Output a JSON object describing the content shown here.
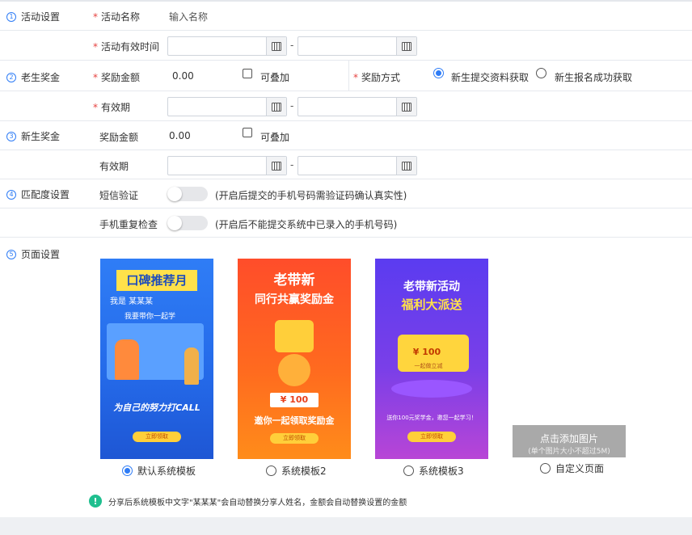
{
  "sections": {
    "activity": {
      "num": "1",
      "label": "活动设置"
    },
    "old": {
      "num": "2",
      "label": "老生奖金"
    },
    "new": {
      "num": "3",
      "label": "新生奖金"
    },
    "match": {
      "num": "4",
      "label": "匹配度设置"
    },
    "page": {
      "num": "5",
      "label": "页面设置"
    }
  },
  "activity": {
    "name_label": "活动名称",
    "name_placeholder": "输入名称",
    "time_label": "活动有效时间",
    "range_sep": "-"
  },
  "old_bonus": {
    "amount_label": "奖励金额",
    "amount_value": "0.00",
    "stackable_label": "可叠加",
    "stackable_checked": false,
    "method_label": "奖励方式",
    "method_options": [
      "新生提交资料获取",
      "新生报名成功获取"
    ],
    "method_selected": "新生提交资料获取",
    "validity_label": "有效期",
    "range_sep": "-"
  },
  "new_bonus": {
    "amount_label": "奖励金额",
    "amount_value": "0.00",
    "stackable_label": "可叠加",
    "stackable_checked": false,
    "validity_label": "有效期",
    "range_sep": "-"
  },
  "matching": {
    "sms_label": "短信验证",
    "sms_enabled": false,
    "sms_hint": "(开启后提交的手机号码需验证码确认真实性)",
    "dup_label": "手机重复检查",
    "dup_enabled": false,
    "dup_hint": "(开启后不能提交系统中已录入的手机号码)"
  },
  "templates": [
    {
      "name": "默认系统模板",
      "selected": true,
      "title": "口碑推荐月",
      "line1": "我是  某某某",
      "line2": "我要带你一起学",
      "footer": "为自己的努力打CALL",
      "cta": "立即领取"
    },
    {
      "name": "系统模板2",
      "selected": false,
      "title1": "老带新",
      "title2": "同行共赢奖励金",
      "amount": "¥ 100",
      "footer": "邀你一起领取奖励金",
      "cta": "立即领取"
    },
    {
      "name": "系统模板3",
      "selected": false,
      "title1": "老带新活动",
      "title2": "福利大派送",
      "amount": "¥ 100",
      "amount_sub": "一起做立减",
      "footer": "送你100元奖学金，邀您一起学习！",
      "cta": "立即领取"
    }
  ],
  "custom_page": {
    "name": "自定义页面",
    "selected": false,
    "upload_label": "点击添加图片",
    "upload_hint": "(单个图片大小不超过5M)"
  },
  "note": "分享后系统模板中文字\"某某某\"会自动替换分享人姓名，金额会自动替换设置的金额",
  "colors": {
    "accent": "#2e7cf6",
    "required": "#e64340",
    "note_icon": "#1fbf8f"
  }
}
